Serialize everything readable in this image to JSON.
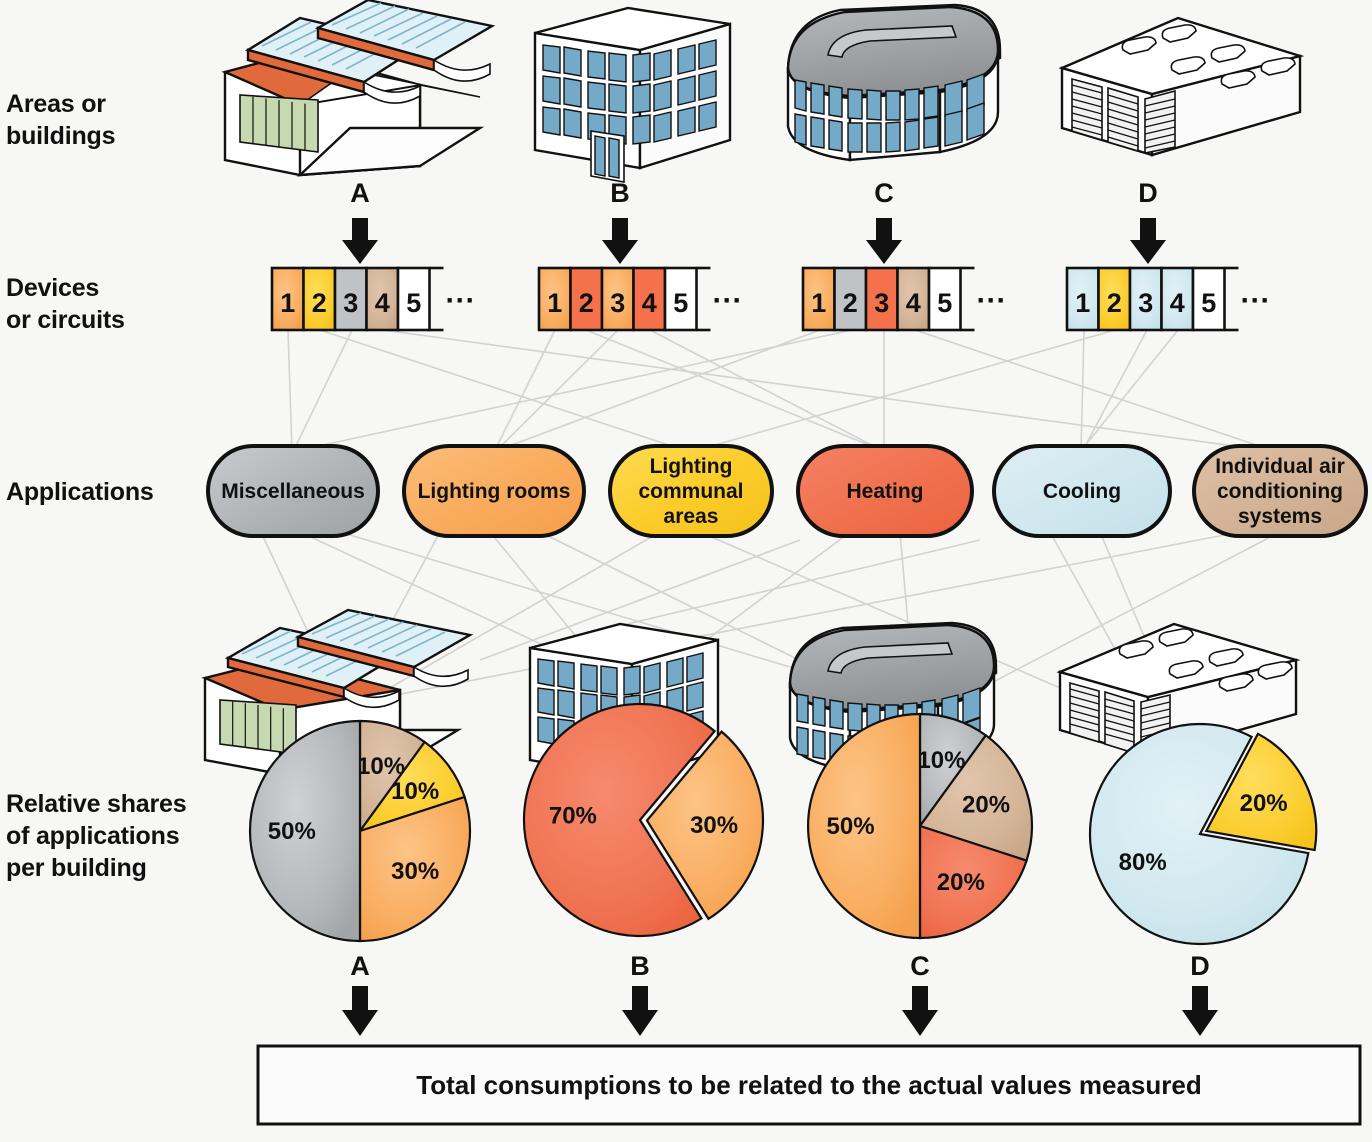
{
  "row_labels": {
    "areas": "Areas or\nbuildings",
    "areas_l1": "Areas or",
    "areas_l2": "buildings",
    "devices_l1": "Devices",
    "devices_l2": "or circuits",
    "applications": "Applications",
    "shares_l1": "Relative shares",
    "shares_l2": "of applications",
    "shares_l3": "per building"
  },
  "buildings_top": [
    {
      "id": "A",
      "label": "A",
      "type": "factory-sawtooth"
    },
    {
      "id": "B",
      "label": "B",
      "type": "office-block"
    },
    {
      "id": "C",
      "label": "C",
      "type": "rounded-commercial"
    },
    {
      "id": "D",
      "label": "D",
      "type": "flat-warehouse"
    }
  ],
  "buildings_bottom": [
    {
      "id": "A",
      "label": "A"
    },
    {
      "id": "B",
      "label": "B"
    },
    {
      "id": "C",
      "label": "C"
    },
    {
      "id": "D",
      "label": "D"
    }
  ],
  "device_groups": [
    {
      "building": "A",
      "ellipsis": "···",
      "devices": [
        {
          "num": "1",
          "color": "#f9ab5c"
        },
        {
          "num": "2",
          "color": "#fbcb28"
        },
        {
          "num": "3",
          "color": "#c0c3c6"
        },
        {
          "num": "4",
          "color": "#d3b295"
        },
        {
          "num": "5",
          "color": "#ffffff"
        }
      ]
    },
    {
      "building": "B",
      "ellipsis": "···",
      "devices": [
        {
          "num": "1",
          "color": "#f9ab5c"
        },
        {
          "num": "2",
          "color": "#f4714b"
        },
        {
          "num": "3",
          "color": "#f9ab5c"
        },
        {
          "num": "4",
          "color": "#f4714b"
        },
        {
          "num": "5",
          "color": "#ffffff"
        }
      ]
    },
    {
      "building": "C",
      "ellipsis": "···",
      "devices": [
        {
          "num": "1",
          "color": "#f9ab5c"
        },
        {
          "num": "2",
          "color": "#c0c3c6"
        },
        {
          "num": "3",
          "color": "#f4714b"
        },
        {
          "num": "4",
          "color": "#d3b295"
        },
        {
          "num": "5",
          "color": "#ffffff"
        }
      ]
    },
    {
      "building": "D",
      "ellipsis": "···",
      "devices": [
        {
          "num": "1",
          "color": "#cfe7ee"
        },
        {
          "num": "2",
          "color": "#fbcb28"
        },
        {
          "num": "3",
          "color": "#cfe7ee"
        },
        {
          "num": "4",
          "color": "#cfe7ee"
        },
        {
          "num": "5",
          "color": "#ffffff"
        }
      ]
    }
  ],
  "applications": [
    {
      "id": "miscellaneous",
      "lines": [
        "Miscellaneous"
      ],
      "color": "#b0b3b6"
    },
    {
      "id": "lighting-rooms",
      "lines": [
        "Lighting rooms"
      ],
      "color": "#f9ab5c"
    },
    {
      "id": "lighting-communal-areas",
      "lines": [
        "Lighting",
        "communal",
        "areas"
      ],
      "color": "#fbcb28"
    },
    {
      "id": "heating",
      "lines": [
        "Heating"
      ],
      "color": "#f0704d"
    },
    {
      "id": "cooling",
      "lines": [
        "Cooling"
      ],
      "color": "#cfe7ee"
    },
    {
      "id": "individual-air-conditioning",
      "lines": [
        "Individual air",
        "conditioning",
        "systems"
      ],
      "color": "#d3b295"
    }
  ],
  "chart_data": [
    {
      "type": "pie",
      "title": "A",
      "labels": [
        "Individual air conditioning systems",
        "Lighting communal areas",
        "Lighting rooms",
        "Miscellaneous"
      ],
      "values": [
        10,
        10,
        30,
        50
      ],
      "value_labels": [
        "10%",
        "10%",
        "30%",
        "50%"
      ],
      "colors": [
        "#d3b295",
        "#fbcb28",
        "#f9ab5c",
        "#b0b3b6"
      ],
      "start_angle": 0,
      "unit": "%"
    },
    {
      "type": "pie",
      "title": "B",
      "labels": [
        "Lighting rooms",
        "Heating"
      ],
      "values": [
        30,
        70
      ],
      "value_labels": [
        "30%",
        "70%"
      ],
      "colors": [
        "#f9ab5c",
        "#f0704d"
      ],
      "start_angle": 40,
      "exploded": [
        true,
        false
      ],
      "unit": "%"
    },
    {
      "type": "pie",
      "title": "C",
      "labels": [
        "Miscellaneous",
        "Individual air conditioning systems",
        "Heating",
        "Lighting rooms"
      ],
      "values": [
        10,
        20,
        20,
        50
      ],
      "value_labels": [
        "10%",
        "20%",
        "20%",
        "50%"
      ],
      "colors": [
        "#b0b3b6",
        "#d3b295",
        "#f0704d",
        "#f9ab5c"
      ],
      "start_angle": 0,
      "unit": "%"
    },
    {
      "type": "pie",
      "title": "D",
      "labels": [
        "Lighting communal areas",
        "Cooling"
      ],
      "values": [
        20,
        80
      ],
      "value_labels": [
        "20%",
        "80%"
      ],
      "colors": [
        "#fbcb28",
        "#cfe7ee"
      ],
      "start_angle": 28,
      "exploded": [
        true,
        false
      ],
      "unit": "%"
    }
  ],
  "footer": {
    "text": "Total consumptions to be related to the actual values measured"
  },
  "colors": {
    "orange": "#f9ab5c",
    "yellow": "#fbcb28",
    "gray": "#b0b3b6",
    "tan": "#d3b295",
    "red": "#f0704d",
    "lightblue": "#cfe7ee",
    "white": "#ffffff",
    "outline": "#111111",
    "link": "#d2d2d2",
    "background": "#f7f7f5"
  }
}
